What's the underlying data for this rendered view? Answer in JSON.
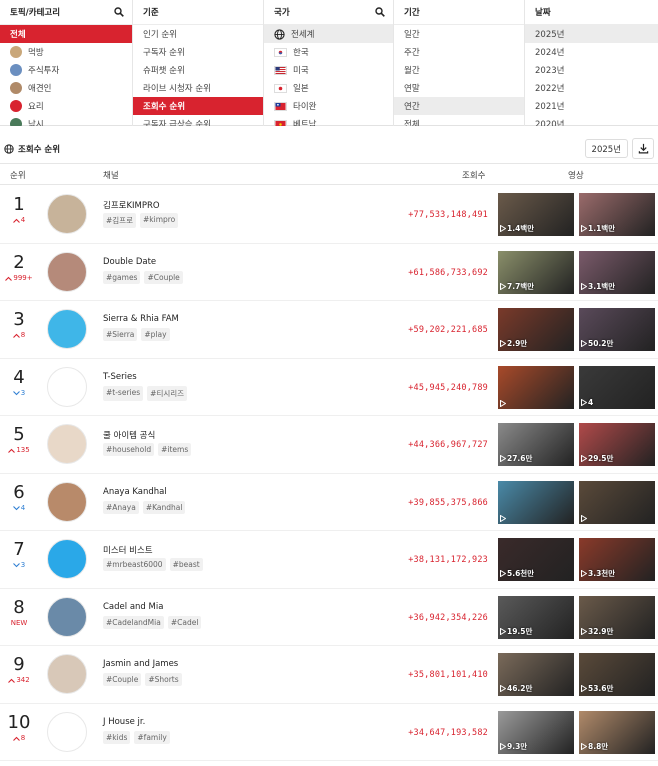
{
  "filters": {
    "topic": {
      "header": "토픽/카테고리",
      "items": [
        {
          "label": "전체",
          "selected": true
        },
        {
          "label": "먹방",
          "color": "#c9a77a"
        },
        {
          "label": "주식투자",
          "color": "#6b8fc0"
        },
        {
          "label": "애견인",
          "color": "#b08a68"
        },
        {
          "label": "요리",
          "color": "#d8232f"
        },
        {
          "label": "낚시",
          "color": "#4a7a5a"
        }
      ]
    },
    "criteria": {
      "header": "기준",
      "items": [
        {
          "label": "인기 순위"
        },
        {
          "label": "구독자 순위"
        },
        {
          "label": "슈퍼챗 순위"
        },
        {
          "label": "라이브 시청자 순위"
        },
        {
          "label": "조회수 순위",
          "selected": true
        },
        {
          "label": "구독자 급상승 순위"
        }
      ]
    },
    "country": {
      "header": "국가",
      "items": [
        {
          "label": "전세계",
          "selected": true,
          "flag": "globe"
        },
        {
          "label": "한국",
          "flag": "kr"
        },
        {
          "label": "미국",
          "flag": "us"
        },
        {
          "label": "일본",
          "flag": "jp"
        },
        {
          "label": "타이완",
          "flag": "tw"
        },
        {
          "label": "베트남",
          "flag": "vn"
        }
      ]
    },
    "period": {
      "header": "기간",
      "items": [
        {
          "label": "일간"
        },
        {
          "label": "주간"
        },
        {
          "label": "월간"
        },
        {
          "label": "연말"
        },
        {
          "label": "연간",
          "selected": true
        },
        {
          "label": "전체"
        }
      ]
    },
    "date": {
      "header": "날짜",
      "items": [
        {
          "label": "2025년",
          "selected": true
        },
        {
          "label": "2024년"
        },
        {
          "label": "2023년"
        },
        {
          "label": "2022년"
        },
        {
          "label": "2021년"
        },
        {
          "label": "2020년"
        }
      ]
    }
  },
  "section": {
    "title": "조회수 순위",
    "year": "2025년"
  },
  "table_header": {
    "rank": "순위",
    "channel": "채널",
    "views": "조회수",
    "videos": "영상"
  },
  "rows": [
    {
      "rank": "1",
      "change": "4",
      "dir": "up",
      "name": "김프로KIMPRO",
      "tags": [
        "#김프로",
        "#kimpro"
      ],
      "views": "+77,533,148,491",
      "v1": "1.4백만",
      "v2": "1.1백만",
      "c1": "#6a5a4a",
      "c2": "#9a6b6b",
      "av": "#c7b39a"
    },
    {
      "rank": "2",
      "change": "999+",
      "dir": "up",
      "name": "Double Date",
      "tags": [
        "#games",
        "#Couple"
      ],
      "views": "+61,586,733,692",
      "v1": "7.7백만",
      "v2": "3.1백만",
      "c1": "#8a8f6a",
      "c2": "#7a5a6a",
      "av": "#b58a7a"
    },
    {
      "rank": "3",
      "change": "8",
      "dir": "up",
      "name": "Sierra & Rhia FAM",
      "tags": [
        "#Sierra",
        "#play"
      ],
      "views": "+59,202,221,685",
      "v1": "2.9만",
      "v2": "50.2만",
      "c1": "#7a3a2a",
      "c2": "#5a4a5a",
      "av": "#3fb6e8"
    },
    {
      "rank": "4",
      "change": "3",
      "dir": "down",
      "name": "T-Series",
      "tags": [
        "#t-series",
        "#티시리즈"
      ],
      "views": "+45,945,240,789",
      "v1": "",
      "v2": "4",
      "c1": "#a84a2a",
      "c2": "#3a3a3a",
      "av": "#ffffff"
    },
    {
      "rank": "5",
      "change": "135",
      "dir": "up",
      "name": "쿨 아이템 공식",
      "tags": [
        "#household",
        "#items"
      ],
      "views": "+44,366,967,727",
      "v1": "27.6만",
      "v2": "29.5만",
      "c1": "#8a8a8a",
      "c2": "#b04a4a",
      "av": "#e8d8c8"
    },
    {
      "rank": "6",
      "change": "4",
      "dir": "down",
      "name": "Anaya Kandhal",
      "tags": [
        "#Anaya",
        "#Kandhal"
      ],
      "views": "+39,855,375,866",
      "v1": "",
      "v2": "",
      "c1": "#4a8aa8",
      "c2": "#5a4a3a",
      "av": "#b88a6a"
    },
    {
      "rank": "7",
      "change": "3",
      "dir": "down",
      "name": "미스터 비스트",
      "tags": [
        "#mrbeast6000",
        "#beast"
      ],
      "views": "+38,131,172,923",
      "v1": "5.6천만",
      "v2": "3.3천만",
      "c1": "#3a2a2a",
      "c2": "#8a3a2a",
      "av": "#2aa8e8"
    },
    {
      "rank": "8",
      "change": "NEW",
      "dir": "new",
      "name": "Cadel and Mia",
      "tags": [
        "#CadelandMia",
        "#Cadel"
      ],
      "views": "+36,942,354,226",
      "v1": "19.5만",
      "v2": "32.9만",
      "c1": "#5a5a5a",
      "c2": "#6a5a4a",
      "av": "#6a8aa8"
    },
    {
      "rank": "9",
      "change": "342",
      "dir": "up",
      "name": "Jasmin and James",
      "tags": [
        "#Couple",
        "#Shorts"
      ],
      "views": "+35,801,101,410",
      "v1": "46.2만",
      "v2": "53.6만",
      "c1": "#7a6a5a",
      "c2": "#5a4a3a",
      "av": "#d8c8b8"
    },
    {
      "rank": "10",
      "change": "8",
      "dir": "up",
      "name": "J House jr.",
      "tags": [
        "#kids",
        "#family"
      ],
      "views": "+34,647,193,582",
      "v1": "9.3만",
      "v2": "8.8만",
      "c1": "#9a9a9a",
      "c2": "#b08a6a",
      "av": "#ffffff"
    }
  ]
}
